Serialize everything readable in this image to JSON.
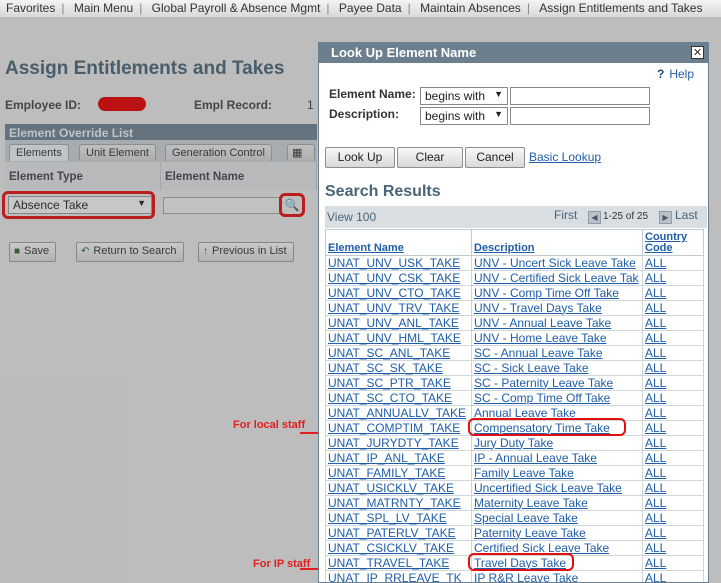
{
  "breadcrumbs": [
    "Favorites",
    "Main Menu",
    "Global Payroll & Absence Mgmt",
    "Payee Data",
    "Maintain Absences",
    "Assign Entitlements and Takes"
  ],
  "page": {
    "title": "Assign Entitlements and Takes",
    "employee_id_label": "Employee ID:",
    "empl_record_label": "Empl Record:",
    "empl_record_value": "1",
    "grid_title": "Element Override List",
    "tabs": [
      "Elements",
      "Unit Element",
      "Generation Control"
    ],
    "col_element_type": "Element Type",
    "col_element_name": "Element Name",
    "element_type_value": "Absence Take",
    "buttons": [
      "Save",
      "Return to Search",
      "Previous in List"
    ]
  },
  "modal": {
    "title": "Look Up Element Name",
    "close": "✕",
    "help": "Help",
    "element_name_label": "Element Name:",
    "description_label": "Description:",
    "operator_1": "begins with",
    "operator_2": "begins with",
    "lookup_button": "Look Up",
    "clear_button": "Clear",
    "cancel_button": "Cancel",
    "basic_lookup": "Basic Lookup",
    "results_title": "Search Results",
    "view_100": "View 100",
    "first": "First",
    "count": "1-25 of 25",
    "last": "Last",
    "columns": [
      "Element Name",
      "Description",
      "Country Code"
    ],
    "rows": [
      [
        "UNAT_UNV_USK_TAKE",
        "UNV - Uncert Sick Leave Take",
        "ALL"
      ],
      [
        "UNAT_UNV_CSK_TAKE",
        "UNV - Certified Sick Leave Tak",
        "ALL"
      ],
      [
        "UNAT_UNV_CTO_TAKE",
        "UNV - Comp Time Off Take",
        "ALL"
      ],
      [
        "UNAT_UNV_TRV_TAKE",
        "UNV - Travel Days Take",
        "ALL"
      ],
      [
        "UNAT_UNV_ANL_TAKE",
        "UNV - Annual Leave Take",
        "ALL"
      ],
      [
        "UNAT_UNV_HML_TAKE",
        "UNV - Home Leave Take",
        "ALL"
      ],
      [
        "UNAT_SC_ANL_TAKE",
        "SC - Annual Leave Take",
        "ALL"
      ],
      [
        "UNAT_SC_SK_TAKE",
        "SC - Sick Leave Take",
        "ALL"
      ],
      [
        "UNAT_SC_PTR_TAKE",
        "SC - Paternity Leave Take",
        "ALL"
      ],
      [
        "UNAT_SC_CTO_TAKE",
        "SC - Comp Time Off Take",
        "ALL"
      ],
      [
        "UNAT_ANNUALLV_TAKE",
        "Annual Leave Take",
        "ALL"
      ],
      [
        "UNAT_COMPTIM_TAKE",
        "Compensatory Time Take",
        "ALL"
      ],
      [
        "UNAT_JURYDTY_TAKE",
        "Jury Duty Take",
        "ALL"
      ],
      [
        "UNAT_IP_ANL_TAKE",
        "IP - Annual Leave Take",
        "ALL"
      ],
      [
        "UNAT_FAMILY_TAKE",
        "Family Leave Take",
        "ALL"
      ],
      [
        "UNAT_USICKLV_TAKE",
        "Uncertified Sick Leave Take",
        "ALL"
      ],
      [
        "UNAT_MATRNTY_TAKE",
        "Maternity Leave Take",
        "ALL"
      ],
      [
        "UNAT_SPL_LV_TAKE",
        "Special Leave Take",
        "ALL"
      ],
      [
        "UNAT_PATERLV_TAKE",
        "Paternity Leave Take",
        "ALL"
      ],
      [
        "UNAT_CSICKLV_TAKE",
        "Certified Sick Leave Take",
        "ALL"
      ],
      [
        "UNAT_TRAVEL_TAKE",
        "Travel Days Take",
        "ALL"
      ],
      [
        "UNAT_IP_RRLEAVE_TK",
        "IP R&R Leave Take",
        "ALL"
      ]
    ]
  },
  "annotations": {
    "local_staff": "For local staff",
    "ip_staff": "For IP staff"
  },
  "colors": {
    "link": "#1f5ea8",
    "highlight": "#e01010",
    "title_bar": "#6c7f8f"
  }
}
